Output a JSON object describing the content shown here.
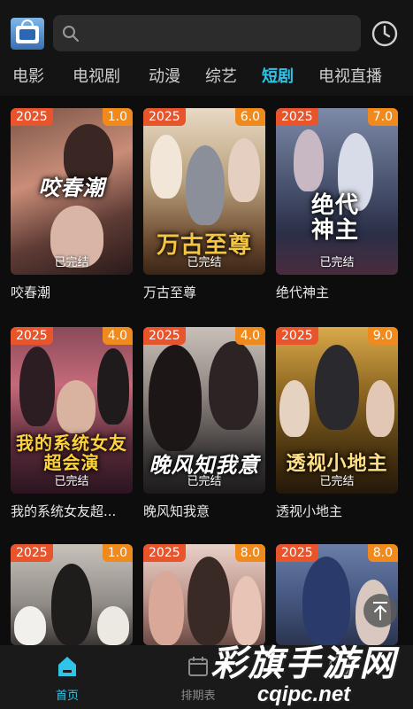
{
  "header": {
    "search_placeholder": "",
    "search_icon": "search-icon",
    "history_icon": "clock-icon",
    "logo_icon": "tv-logo-icon"
  },
  "tabs": [
    {
      "label": "电影",
      "active": false
    },
    {
      "label": "电视剧",
      "active": false
    },
    {
      "label": "动漫",
      "active": false
    },
    {
      "label": "综艺",
      "active": false
    },
    {
      "label": "短剧",
      "active": true
    },
    {
      "label": "电视直播",
      "active": false
    }
  ],
  "colors": {
    "accent": "#2fc4e8",
    "year_badge": "#e8542b",
    "score_badge": "#f08a1c",
    "background": "#0d0d0d"
  },
  "cards": [
    {
      "year": "2025",
      "score": "1.0",
      "status": "已完结",
      "title": "咬春潮",
      "poster_text": "咬春潮"
    },
    {
      "year": "2025",
      "score": "6.0",
      "status": "已完结",
      "title": "万古至尊",
      "poster_text": "万古至尊"
    },
    {
      "year": "2025",
      "score": "7.0",
      "status": "已完结",
      "title": "绝代神主",
      "poster_text": "绝代神主"
    },
    {
      "year": "2025",
      "score": "4.0",
      "status": "已完结",
      "title": "我的系统女友超...",
      "poster_text": "我的系统女友超会演"
    },
    {
      "year": "2025",
      "score": "4.0",
      "status": "已完结",
      "title": "晚风知我意",
      "poster_text": "晚风知我意"
    },
    {
      "year": "2025",
      "score": "9.0",
      "status": "已完结",
      "title": "透视小地主",
      "poster_text": "透视小地主"
    },
    {
      "year": "2025",
      "score": "1.0",
      "status": "",
      "title": "",
      "poster_text": ""
    },
    {
      "year": "2025",
      "score": "8.0",
      "status": "",
      "title": "",
      "poster_text": ""
    },
    {
      "year": "2025",
      "score": "8.0",
      "status": "",
      "title": "",
      "poster_text": ""
    }
  ],
  "back_to_top_icon": "arrow-up-icon",
  "bottom_nav": [
    {
      "label": "首页",
      "icon": "home-icon",
      "active": true
    },
    {
      "label": "排期表",
      "icon": "calendar-icon",
      "active": false
    },
    {
      "label": "",
      "icon": "user-icon",
      "active": false
    }
  ],
  "watermark": {
    "line1": "彩旗手游网",
    "line2": "cqipc.net"
  }
}
